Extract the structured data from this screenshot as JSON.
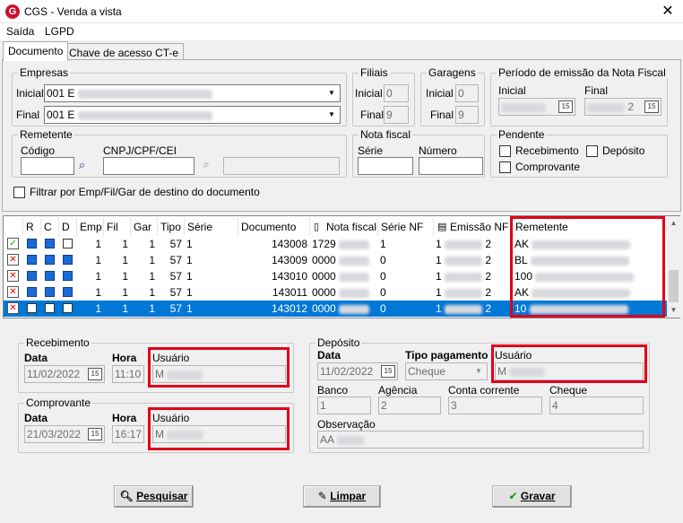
{
  "window": {
    "title": "CGS - Venda a vista",
    "close": "✕"
  },
  "menu": [
    "Saída",
    "LGPD"
  ],
  "tabs": [
    "Documento",
    "Chave de acesso CT-e"
  ],
  "empresas": {
    "legend": "Empresas",
    "inicial_label": "Inicial",
    "inicial_value": "001 E",
    "final_label": "Final",
    "final_value": "001 E"
  },
  "filiais": {
    "legend": "Filiais",
    "inicial_label": "Inicial",
    "inicial_value": "0",
    "final_label": "Final",
    "final_value": "9"
  },
  "garagens": {
    "legend": "Garagens",
    "inicial_label": "Inicial",
    "inicial_value": "0",
    "final_label": "Final",
    "final_value": "9"
  },
  "periodo": {
    "legend": "Período de emissão da Nota Fiscal",
    "inicial_label": "Inicial",
    "final_label": "Final",
    "final_value": "2",
    "cal": "15"
  },
  "remetente": {
    "legend": "Remetente",
    "codigo_label": "Código",
    "cnpj_label": "CNPJ/CPF/CEI"
  },
  "nota_fiscal": {
    "legend": "Nota fiscal",
    "serie_label": "Série",
    "numero_label": "Número"
  },
  "pendente": {
    "legend": "Pendente",
    "recebimento": "Recebimento",
    "deposito": "Depósito",
    "comprovante": "Comprovante"
  },
  "filtrar_label": "Filtrar por Emp/Fil/Gar de destino do documento",
  "grid": {
    "headers": [
      "",
      "R",
      "C",
      "D",
      "Emp",
      "Fil",
      "Gar",
      "Tipo",
      "Série",
      "Documento",
      "Nota fiscal",
      "Série NF",
      "Emissão NF",
      "Remetente"
    ],
    "rows": [
      {
        "status": "✓",
        "r": true,
        "c": true,
        "d": false,
        "emp": "1",
        "fil": "1",
        "gar": "1",
        "tipo": "57",
        "serie": "1",
        "documento": "143008",
        "nota": "1729",
        "serie_nf": "1",
        "emissao_pre": "1",
        "emissao_suf": "2",
        "remetente": "AK"
      },
      {
        "status": "✕",
        "r": true,
        "c": true,
        "d": true,
        "emp": "1",
        "fil": "1",
        "gar": "1",
        "tipo": "57",
        "serie": "1",
        "documento": "143009",
        "nota": "0000",
        "serie_nf": "0",
        "emissao_pre": "1",
        "emissao_suf": "2",
        "remetente": "BL"
      },
      {
        "status": "✕",
        "r": true,
        "c": true,
        "d": true,
        "emp": "1",
        "fil": "1",
        "gar": "1",
        "tipo": "57",
        "serie": "1",
        "documento": "143010",
        "nota": "0000",
        "serie_nf": "0",
        "emissao_pre": "1",
        "emissao_suf": "2",
        "remetente": "100"
      },
      {
        "status": "✕",
        "r": true,
        "c": true,
        "d": true,
        "emp": "1",
        "fil": "1",
        "gar": "1",
        "tipo": "57",
        "serie": "1",
        "documento": "143011",
        "nota": "0000",
        "serie_nf": "0",
        "emissao_pre": "1",
        "emissao_suf": "2",
        "remetente": "AK"
      },
      {
        "status": "✕",
        "r": false,
        "c": false,
        "d": false,
        "emp": "1",
        "fil": "1",
        "gar": "1",
        "tipo": "57",
        "serie": "1",
        "documento": "143012",
        "nota": "0000",
        "serie_nf": "0",
        "emissao_pre": "1",
        "emissao_suf": "2",
        "remetente": "10",
        "selected": true
      }
    ]
  },
  "recebimento": {
    "legend": "Recebimento",
    "data_label": "Data",
    "data_value": "11/02/2022",
    "hora_label": "Hora",
    "hora_value": "11:10",
    "usuario_label": "Usuário",
    "usuario_value": "M"
  },
  "comprovante": {
    "legend": "Comprovante",
    "data_label": "Data",
    "data_value": "21/03/2022",
    "hora_label": "Hora",
    "hora_value": "16:17",
    "usuario_label": "Usuário",
    "usuario_value": "M"
  },
  "deposito": {
    "legend": "Depósito",
    "data_label": "Data",
    "data_value": "11/02/2022",
    "tipo_label": "Tipo pagamento",
    "tipo_value": "Cheque",
    "usuario_label": "Usuário",
    "usuario_value": "M",
    "banco_label": "Banco",
    "banco_value": "1",
    "agencia_label": "Agência",
    "agencia_value": "2",
    "conta_label": "Conta corrente",
    "conta_value": "3",
    "cheque_label": "Cheque",
    "cheque_value": "4",
    "obs_label": "Observação",
    "obs_value": "AA"
  },
  "buttons": {
    "pesquisar": "Pesquisar",
    "limpar": "Limpar",
    "gravar": "Gravar"
  },
  "colors": {
    "accent": "#0078d7",
    "highlight": "#e0001b",
    "check_fill": "#1a6ad8"
  }
}
